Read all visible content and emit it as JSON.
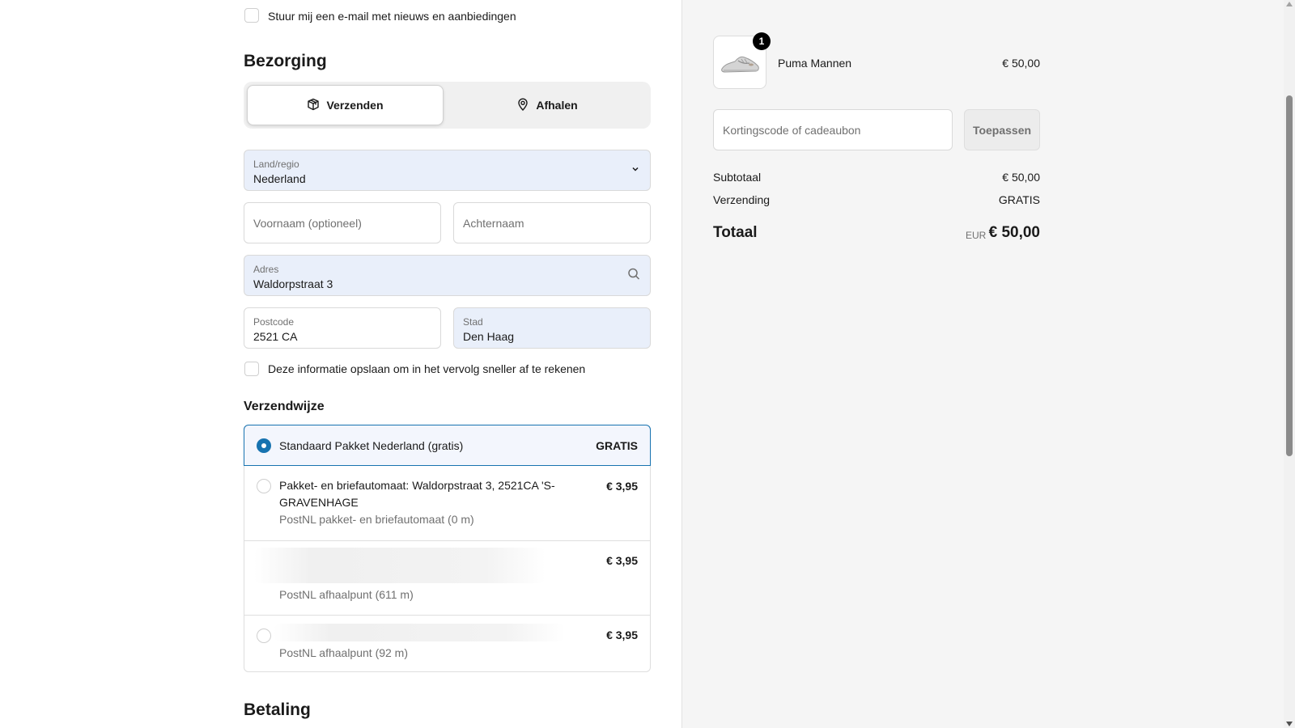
{
  "marketing": {
    "checkbox_label": "Stuur mij een e-mail met nieuws en aanbiedingen"
  },
  "delivery": {
    "heading": "Bezorging",
    "tabs": [
      {
        "label": "Verzenden",
        "icon": "package-icon",
        "active": true
      },
      {
        "label": "Afhalen",
        "icon": "location-pin-icon",
        "active": false
      }
    ],
    "country": {
      "label": "Land/regio",
      "value": "Nederland"
    },
    "first_name": {
      "placeholder": "Voornaam (optioneel)",
      "value": ""
    },
    "last_name": {
      "placeholder": "Achternaam",
      "value": ""
    },
    "address": {
      "label": "Adres",
      "value": "Waldorpstraat 3"
    },
    "postcode": {
      "label": "Postcode",
      "value": "2521 CA"
    },
    "city": {
      "label": "Stad",
      "value": "Den Haag"
    },
    "save_info_label": "Deze informatie opslaan om in het vervolg sneller af te rekenen"
  },
  "shipping": {
    "heading": "Verzendwijze",
    "options": [
      {
        "title": "Standaard Pakket Nederland (gratis)",
        "subtitle": "",
        "price": "GRATIS",
        "selected": true
      },
      {
        "title": "Pakket- en briefautomaat: Waldorpstraat 3, 2521CA 'S-GRAVENHAGE",
        "subtitle": "PostNL pakket- en briefautomaat (0 m)",
        "price": "€ 3,95",
        "selected": false
      },
      {
        "title": "",
        "subtitle": "PostNL afhaalpunt (611 m)",
        "price": "€ 3,95",
        "selected": false
      },
      {
        "title": "",
        "subtitle": "PostNL afhaalpunt (92 m)",
        "price": "€ 3,95",
        "selected": false
      }
    ]
  },
  "payment": {
    "heading": "Betaling"
  },
  "summary": {
    "product": {
      "name": "Puma Mannen",
      "price": "€ 50,00",
      "quantity": "1"
    },
    "discount": {
      "placeholder": "Kortingscode of cadeaubon",
      "button": "Toepassen"
    },
    "subtotal_label": "Subtotaal",
    "subtotal_value": "€ 50,00",
    "shipping_label": "Verzending",
    "shipping_value": "GRATIS",
    "total_label": "Totaal",
    "currency": "EUR",
    "total_value": "€ 50,00"
  },
  "colors": {
    "accent": "#1773b0",
    "filled_field": "#e9effa",
    "sidebar_bg": "#f5f5f5"
  }
}
